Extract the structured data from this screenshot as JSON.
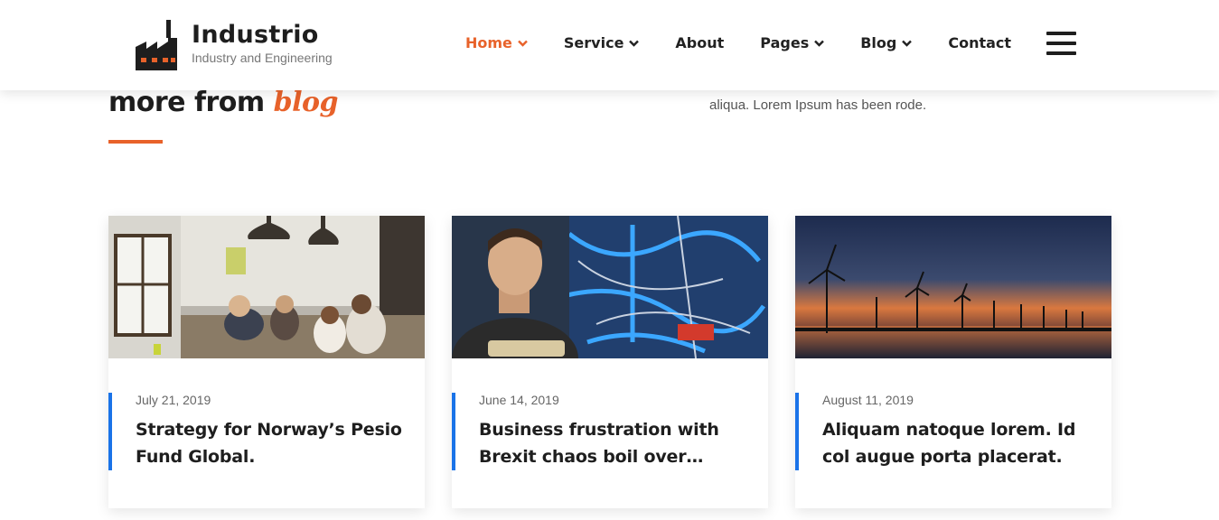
{
  "header": {
    "brand_title": "Industrio",
    "brand_subtitle": "Industry and Engineering",
    "nav": [
      {
        "label": "Home",
        "has_dropdown": true,
        "active": true
      },
      {
        "label": "Service",
        "has_dropdown": true,
        "active": false
      },
      {
        "label": "About",
        "has_dropdown": false,
        "active": false
      },
      {
        "label": "Pages",
        "has_dropdown": true,
        "active": false
      },
      {
        "label": "Blog",
        "has_dropdown": true,
        "active": false
      },
      {
        "label": "Contact",
        "has_dropdown": false,
        "active": false
      }
    ],
    "menu_icon": "hamburger-icon"
  },
  "section": {
    "title_prefix": "more from",
    "title_accent": "blog",
    "description": "aliqua. Lorem Ipsum has been rode."
  },
  "posts": [
    {
      "date": "July 21, 2019",
      "title": "Strategy for Norway’s Pesio Fund Global.",
      "image": "office-meeting-photo"
    },
    {
      "date": "June 14, 2019",
      "title": "Business frustration with Brexit chaos boil over…",
      "image": "engineer-with-machine-photo"
    },
    {
      "date": "August 11, 2019",
      "title": "Aliquam natoque lorem. Id col augue porta placerat.",
      "image": "wind-turbines-sunset-photo"
    }
  ],
  "colors": {
    "accent": "#e8622a",
    "card_bar": "#1a73e8",
    "text_dark": "#1e1e1e"
  }
}
